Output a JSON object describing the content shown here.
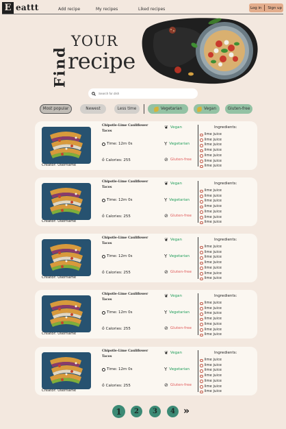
{
  "brand": {
    "letter": "E",
    "name": "eattt"
  },
  "nav": {
    "add_recipe": "Add recipe",
    "my_recipes": "My recipes",
    "liked_recipes": "Liked recipes"
  },
  "auth": {
    "login": "Log in",
    "signup": "Sign up"
  },
  "hero": {
    "find": "Find",
    "your": "YOUR",
    "recipe": "recipe"
  },
  "search": {
    "placeholder": "Search for dish",
    "value": ""
  },
  "filters": [
    {
      "label": "Most popular",
      "active": true
    },
    {
      "label": "Newest"
    },
    {
      "label": "Less time"
    },
    {
      "label": "Vegetarian"
    },
    {
      "label": "Vegan"
    },
    {
      "label": "Gluten-free"
    }
  ],
  "recipe_card": {
    "title": "Chipotle-Lime Cauliflower Tacos",
    "time": "Time: 12m 0s",
    "calories": "Calories:  255",
    "tags": {
      "vegan": "Vegan",
      "vegetarian": "Vegetarian",
      "gluten_free": "Gluten-free"
    },
    "ingredients_title": "Ingredients:",
    "ingredients": [
      "lime juice",
      "lime juice",
      "lime juice",
      "lime juice",
      "lime juice",
      "lime juice",
      "lime juice"
    ],
    "creator": "Creator: Username"
  },
  "pagination": {
    "pages": [
      "1",
      "2",
      "3",
      "4"
    ],
    "current": "1",
    "next": "»"
  },
  "colors": {
    "background": "#f3e8df",
    "card": "#fbf7f1",
    "accent": "#3c8a75",
    "vegan": "#1f9d5a",
    "gluten_free": "#e05b5b",
    "auth": "#e3ad8c"
  }
}
